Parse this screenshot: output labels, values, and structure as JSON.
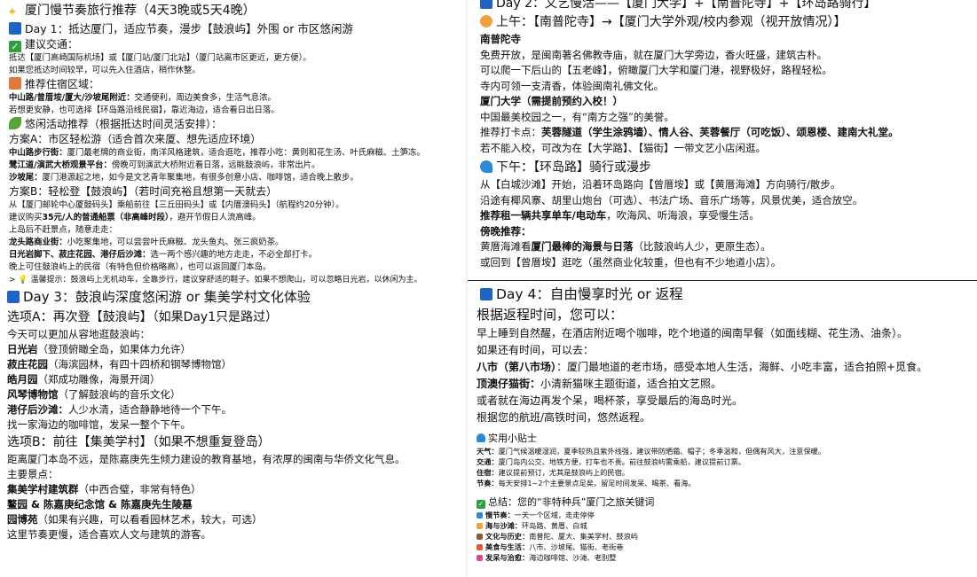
{
  "colors": {
    "calendar": "#1f63c6",
    "check": "#2e9e3e",
    "sun": "#f2a23a",
    "wave": "#2a8ad6",
    "leaf": "#5aa33a",
    "house": "#e07a3a",
    "bulb": "#e0b830",
    "star": "#f0c020"
  },
  "left": {
    "title": "厦门慢节奏旅行推荐（4天3晚或5天4晚）",
    "day1": {
      "title": "Day 1：抵达厦门，适应节奏，漫步【鼓浪屿】外围 or 市区悠闲游",
      "transport_head": "建议交通：",
      "transport_1": "抵达【厦门高崎国际机场】或【厦门站/厦门北站】（厦门站离市区更近，更方便）。",
      "transport_2": "如果您抵达时间较早，可以先入住酒店，稍作休整。",
      "stay_head": "推荐住宿区域：",
      "stay_1_b": "中山路/曾厝垵/厦大/沙坡尾附近：",
      "stay_1": "交通便利，周边美食多，生活气息浓。",
      "stay_2": "若想更安静，也可选择【环岛路沿线民宿】，靠近海边，适合看日出日落。",
      "act_head": "悠闲活动推荐（根据抵达时间灵活安排）：",
      "planA": "方案A：市区轻松游（适合首次来厦、想先适应环境）",
      "a1_b": "中山路步行街：",
      "a1": "厦门最老牌的商业街，南洋风格建筑，适合逛吃，推荐小吃：黄则和花生汤、叶氏麻糍、土笋冻。",
      "a2_b": "鹭江道/演武大桥观景平台：",
      "a2": "傍晚可到演武大桥附近看日落，远眺鼓浪屿，非常出片。",
      "a3_b": "沙坡尾：",
      "a3": "厦门港源起之地，如今是文艺青年聚集地，有很多创意小店、咖啡馆，适合晚上散步。",
      "planB": "方案B：轻松登【鼓浪屿】（若时间充裕且想第一天就去）",
      "b1": "从【厦门邮轮中心厦鼓码头】乘船前往【三丘田码头】或【内厝澳码头】（航程约20分钟）。",
      "b2_pre": "建议购买",
      "b2_b": "35元/人的普通船票（非高峰时段）",
      "b2": "，避开节假日人流高峰。",
      "b3": "上岛后不赶景点，随意走走：",
      "b4_b": "龙头路商业街：",
      "b4": "小吃聚集地，可以尝尝叶氏麻糍、龙头鱼丸、张三疯奶茶。",
      "b5_b": "日光岩脚下、菽庄花园、港仔后沙滩：",
      "b5": "选一两个感兴趣的地方走走，不必全部打卡。",
      "b6": "晚上可住鼓浪屿上的民宿（有特色但价格略高），也可以返回厦门本岛。",
      "tip": "> 💡 温馨提示：鼓浪屿上无机动车，全靠步行，建议穿舒适的鞋子。如果不想爬山，可以忽略日光岩，以休闲为主。"
    },
    "day3": {
      "title": "Day 3：鼓浪屿深度悠闲游 or 集美学村文化体验",
      "optA": "选项A：再次登【鼓浪屿】（如果Day1只是路过）",
      "a_intro": "今天可以更加从容地逛鼓浪屿：",
      "a1_b": "日光岩",
      "a1": "（登顶俯瞰全岛，如果体力允许）",
      "a2_b": "菽庄花园",
      "a2": "（海滨园林，有四十四桥和钢琴博物馆）",
      "a3_b": "皓月园",
      "a3": "（郑成功雕像，海景开阔）",
      "a4_b": "风琴博物馆",
      "a4": "（了解鼓浪屿的音乐文化）",
      "a5_b": "港仔后沙滩：",
      "a5": "人少水清，适合静静地待一个下午。",
      "a6": "找一家海边的咖啡馆，发呆一整个下午。",
      "optB": "选项B：前往【集美学村】（如果不想重复登岛）",
      "b_intro": "距离厦门本岛不远，是陈嘉庚先生倾力建设的教育基地，有浓厚的闽南与华侨文化气息。",
      "b_head": "主要景点：",
      "b1_b": "集美学村建筑群",
      "b1": "（中西合璧，非常有特色）",
      "b2_b": "鳌园 & 陈嘉庚纪念馆 & 陈嘉庚先生陵墓",
      "b3_b": "园博苑",
      "b3": "（如果有兴趣，可以看看园林艺术，较大，可选）",
      "b4": "这里节奏更慢，适合喜欢人文与建筑的游客。"
    }
  },
  "right": {
    "day2": {
      "title": "Day 2：文艺慢活——【厦门大学】+【南普陀寺】+【环岛路骑行】",
      "am": "上午：【南普陀寺】→【厦门大学外观/校内参观（视开放情况）】",
      "np_head": "南普陀寺",
      "np1": "免费开放，是闽南著名佛教寺庙，就在厦门大学旁边，香火旺盛，建筑古朴。",
      "np2": "可以爬一下后山的【五老峰】，俯瞰厦门大学和厦门港，视野极好，路程轻松。",
      "np3": "寺内可领一支清香，体验闽南礼佛文化。",
      "xm_head": "厦门大学（需提前预约入校！）",
      "xm1": "中国最美校园之一，有“南方之强”的美誉。",
      "xm2_pre": "推荐打卡点：",
      "xm2_b": "芙蓉隧道（学生涂鸦墙）、情人谷、芙蓉餐厅（可吃饭）、颂恩楼、建南大礼堂。",
      "xm3": "若不能入校，可改为在【大学路】、【猫街】一带文艺小店闲逛。",
      "pm": "下午：【环岛路】骑行或漫步",
      "pm1": "从【白城沙滩】开始，沿着环岛路向【曾厝垵】或【黄厝海滩】方向骑行/散步。",
      "pm2": "沿途有椰风寨、胡里山炮台（可选）、书法广场、音乐广场等，风景优美，适合放空。",
      "pm3_b": "推荐租一辆共享单车/电动车",
      "pm3": "，吹海风、听海浪，享受慢生活。",
      "pm4_b": "傍晚推荐：",
      "pm5_pre": "黄厝海滩看",
      "pm5_b": "厦门最棒的海景与日落",
      "pm5": "（比鼓浪屿人少，更原生态）。",
      "pm6": "或回到【曾厝垵】逛吃（虽然商业化较重，但也有不少地道小店）。"
    },
    "day4": {
      "title": "Day 4：自由慢享时光 or 返程",
      "intro": "根据返程时间，您可以：",
      "l1": "早上睡到自然醒，在酒店附近喝个咖啡，吃个地道的闽南早餐（如面线糊、花生汤、油条）。",
      "l2": "如果还有时间，可以去：",
      "l3_b": "八市（第八市场）",
      "l3": "：厦门最地道的老市场，感受本地人生活，海鲜、小吃丰富，适合拍照+觅食。",
      "l4_b": "顶澳仔猫街：",
      "l4": "小清新猫咪主题街道，适合拍文艺照。",
      "l5": "或者就在海边再发个呆，喝杯茶，享受最后的海岛时光。",
      "l6": "根据您的航班/高铁时间，悠然返程。"
    },
    "tips": {
      "head": "实用小贴士",
      "t1_b": "天气：",
      "t1": "厦门气候温暖湿润，夏季较热且紫外线强，建议带防晒霜、帽子；冬季温和，但偶有风大，注意保暖。",
      "t2_b": "交通：",
      "t2": "厦门岛内公交、地铁方便，打车也不贵。前往鼓浪屿需乘船，建议提前订票。",
      "t3_b": "住宿：",
      "t3": "建议提前预订，尤其是鼓浪屿上的民宿。",
      "t4_b": "节奏：",
      "t4": "每天安排1~2个主要景点足矣，留足时间发呆、喝茶、看海。"
    },
    "summary": {
      "head": "总结：您的“非特种兵”厦门之旅关键词",
      "k1_b": "慢节奏：",
      "k1": "一天一个区域，走走停停",
      "k2_b": "海与沙滩：",
      "k2": "环岛路、黄厝、白城",
      "k3_b": "文化与历史：",
      "k3": "南普陀、厦大、集美学村、鼓浪屿",
      "k4_b": "美食与生活：",
      "k4": "八市、沙坡尾、猫街、老街巷",
      "k5_b": "发呆与治愈：",
      "k5": "海边咖啡馆、沙滩、老别墅"
    }
  }
}
